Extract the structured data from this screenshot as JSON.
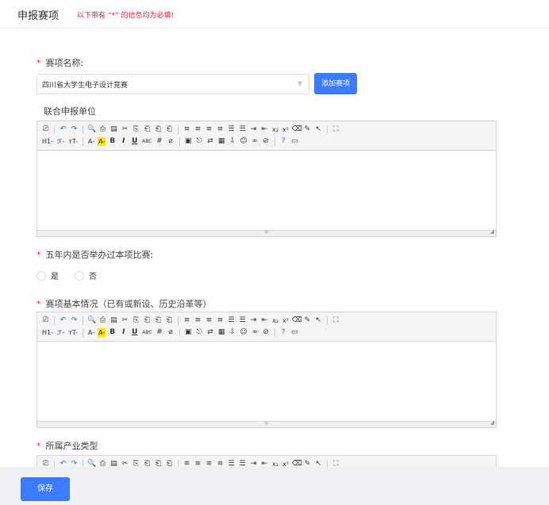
{
  "header": {
    "title": "申报赛项",
    "notice": "以下带有 “*” 的信息均为必填!"
  },
  "form": {
    "required_mark": "*",
    "event_name_label": "赛项名称:",
    "event_select_value": "四川省大学生电子设计竞赛",
    "add_event_button": "添加赛项",
    "joint_unit_label": "联合申报单位",
    "held_label": "五年内是否举办过本项比赛:",
    "radio_yes": "是",
    "radio_no": "否",
    "basic_info_label": "赛项基本情况（已有或新设、历史沿革等）",
    "industry_label": "所属产业类型"
  },
  "editor_toolbar": {
    "row1": [
      "⎚",
      "|",
      "↶",
      "↷",
      "|",
      "🔍",
      "⎙",
      "▤",
      "✂",
      "⎘",
      "⎗",
      "⎗",
      "⎗",
      "|",
      "≡",
      "≡",
      "≡",
      "≡",
      "☰",
      "☰",
      "⇥",
      "⇤",
      "x₂",
      "x²",
      "⌫",
      "✎",
      "↖",
      "|",
      "⛶"
    ],
    "row2": [
      "H1-",
      "ℱ-",
      "тT-",
      "|",
      "A-",
      "A-",
      "B",
      "I",
      "U",
      "ABC",
      "#",
      "⌀",
      "|",
      "▣",
      "⎋",
      "⇄",
      "▦",
      "⇩",
      "☺",
      "∞",
      "⊘",
      "|",
      "?",
      "▭"
    ]
  },
  "footer": {
    "save_button": "保存"
  }
}
